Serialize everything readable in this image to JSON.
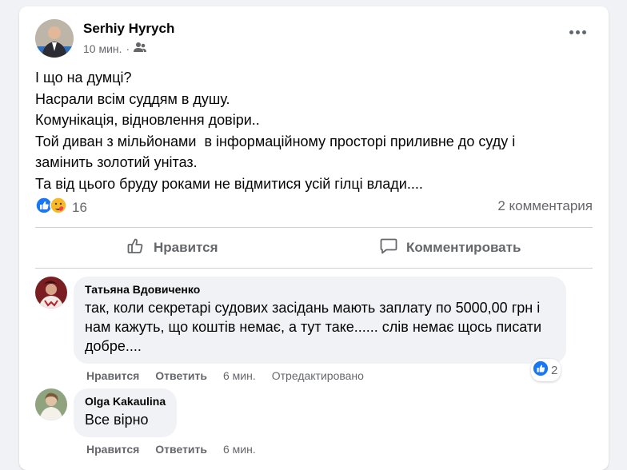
{
  "post": {
    "author": "Serhiy Hyrych",
    "time": "10 мин.",
    "lines": [
      "І що на думці?",
      "Насрали всім суддям в душу.",
      "Комунікація, відновлення довіри..",
      "Той диван з мільйонами  в інформаційному просторі приливне до суду і",
      "замінить золотий унітаз.",
      "Та від цього бруду роками не відмитися усій гілці влади...."
    ],
    "reaction_count": "16",
    "comment_count": "2 комментария"
  },
  "actions": {
    "like": "Нравится",
    "comment": "Комментировать"
  },
  "comments": [
    {
      "name": "Татьяна Вдовиченко",
      "text": "так, коли секретарі судових засідань мають заплату по 5000,00 грн і нам кажуть, що коштів немає, а тут таке...... слів немає щось писати добре....",
      "like": "Нравится",
      "reply": "Ответить",
      "time": "6 мин.",
      "edited": "Отредактировано",
      "reactions": "2"
    },
    {
      "name": "Olga Kakaulina",
      "text": "Все вірно",
      "like": "Нравится",
      "reply": "Ответить",
      "time": "6 мин."
    }
  ],
  "colors": {
    "like_blue": "#1877f2",
    "secondary_text": "#65676b",
    "bubble_bg": "#f0f2f5"
  }
}
